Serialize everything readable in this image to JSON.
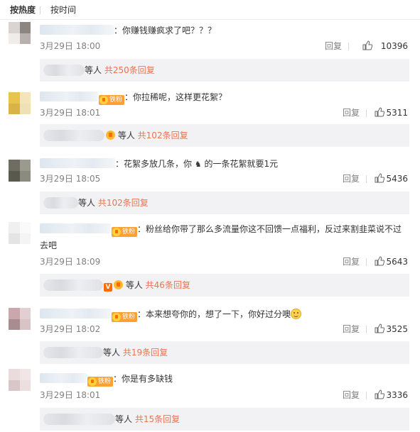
{
  "sort_tabs": {
    "hot": "按热度",
    "time": "按时间"
  },
  "reply_label": "回复",
  "colors": {
    "link": "#eb7350",
    "badge": "#ffa033"
  },
  "comments": [
    {
      "text": "：你赚钱赚疯求了吧？？？",
      "time": "3月29日 18:00",
      "likes": "10396",
      "badge": "",
      "reply_prefix": "等人",
      "reply_link": "共250条回复",
      "emoji": ""
    },
    {
      "text": "：你拉稀呢，这样更花絮？",
      "time": "3月29日 18:01",
      "likes": "5311",
      "badge": "铁粉",
      "reply_prefix": "等人",
      "reply_link": "共102条回复",
      "emoji": ""
    },
    {
      "text": "：花絮多放几条，你",
      "text2": "的一条花絮就要1元",
      "time": "3月29日 18:05",
      "likes": "5436",
      "badge": "",
      "reply_prefix": "等人",
      "reply_link": "共102条回复",
      "emoji": ""
    },
    {
      "text": "：粉丝给你带了那么多流量你这不回馈一点福利，反过来割韭菜说不过",
      "text_cont": "去吧",
      "time": "3月29日 18:09",
      "likes": "5643",
      "badge": "铁粉",
      "reply_prefix": "等人",
      "reply_link": "共46条回复",
      "emoji": ""
    },
    {
      "text": "：本来想夸你的，想了一下，你好过分噢",
      "time": "3月29日 18:02",
      "likes": "3525",
      "badge": "铁粉",
      "reply_prefix": "等人",
      "reply_link": "共19条回复",
      "emoji": "smile"
    },
    {
      "text": "：你是有多缺钱",
      "time": "3月29日 18:01",
      "likes": "3336",
      "badge": "铁粉",
      "reply_prefix": "等人",
      "reply_link": "共15条回复",
      "emoji": ""
    }
  ]
}
